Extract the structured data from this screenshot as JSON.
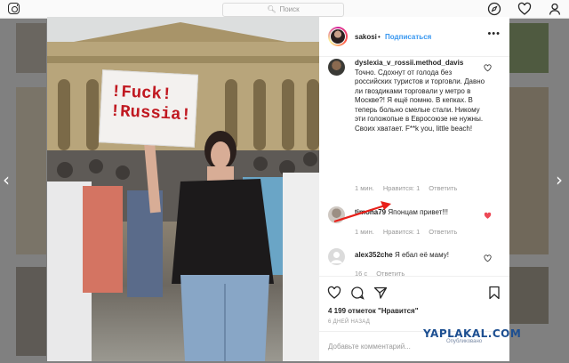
{
  "topbar": {
    "search_placeholder": "Поиск",
    "icons": [
      "instagram-logo",
      "explore-compass-icon",
      "heart-icon",
      "profile-icon"
    ]
  },
  "post": {
    "sign_text": "!Fuck!\n!Russia!",
    "username": "sakosi",
    "follow_label": "Подписаться",
    "more_label": "•••",
    "comments": [
      {
        "username": "dyslexia_v_rossii.method_davis",
        "text": "Точно. Сдохнут от голода без российских туристов и торговли. Давно ли гвоздиками торговали у метро в Москве?! Я ещё помню. В кепках. В теперь больно смелые стали. Никому эти голожопые в Евросоюзе не нужны. Своих хватает. F**k you, little beach!",
        "time": "1 мин.",
        "likes": "Нравится: 1",
        "reply": "Ответить",
        "liked": false
      },
      {
        "username": "timoha79",
        "text": "Японцам привет!!!",
        "time": "1 мин.",
        "likes": "Нравится: 1",
        "reply": "Ответить",
        "liked": true
      },
      {
        "username": "alex352che",
        "text": "Я ебал её маму!",
        "time": "16 с",
        "likes": "",
        "reply": "Ответить",
        "liked": false
      }
    ],
    "likes_count": "4 199 отметок \"Нравится\"",
    "posted_ago": "6 ДНЕЙ НАЗАД",
    "add_comment_placeholder": "Добавьте комментарий..."
  },
  "watermark": {
    "main": "YAPLAKAL.COM",
    "sub": "Опубликовано"
  },
  "colors": {
    "link_blue": "#3897f0",
    "liked_red": "#ed4956",
    "annotation_arrow": "#e8201a"
  }
}
